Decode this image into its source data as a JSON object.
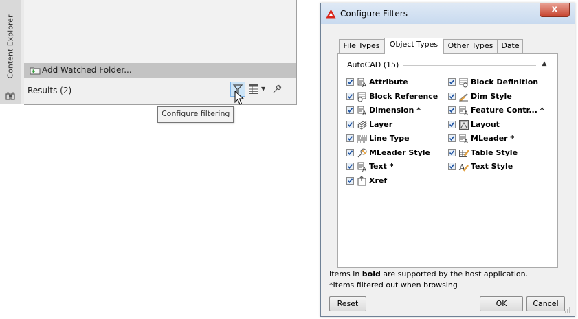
{
  "palette": {
    "vertical_title": "Content Explorer",
    "add_watched_folder_label": "Add Watched Folder...",
    "results_label": "Results (2)",
    "tooltip": "Configure filtering",
    "icons": [
      "binoculars-icon",
      "folder-add-icon",
      "filter-icon",
      "grid-view-icon",
      "dropdown-arrow-icon",
      "wrench-icon",
      "mouse-cursor-icon"
    ]
  },
  "dialog": {
    "title": "Configure Filters",
    "close_label": "x",
    "tabs": [
      {
        "label": "File Types",
        "active": false
      },
      {
        "label": "Object Types",
        "active": true
      },
      {
        "label": "Other Types",
        "active": false
      },
      {
        "label": "Date",
        "active": false
      }
    ],
    "group": {
      "label": "AutoCAD (15)",
      "collapse_icon": "chevron-up-icon"
    },
    "items": [
      {
        "label": "Attribute",
        "checked": true,
        "icon": "attribute-icon"
      },
      {
        "label": "Block Definition",
        "checked": true,
        "icon": "block-definition-icon"
      },
      {
        "label": "Block Reference",
        "checked": true,
        "icon": "block-reference-icon"
      },
      {
        "label": "Dim Style",
        "checked": true,
        "icon": "dim-style-icon"
      },
      {
        "label": "Dimension *",
        "checked": true,
        "icon": "dimension-icon"
      },
      {
        "label": "Feature Contr... *",
        "checked": true,
        "icon": "feature-control-icon"
      },
      {
        "label": "Layer",
        "checked": true,
        "icon": "layer-icon"
      },
      {
        "label": "Layout",
        "checked": true,
        "icon": "layout-icon"
      },
      {
        "label": "Line Type",
        "checked": true,
        "icon": "line-type-icon"
      },
      {
        "label": "MLeader *",
        "checked": true,
        "icon": "mleader-icon"
      },
      {
        "label": "MLeader Style",
        "checked": true,
        "icon": "mleader-style-icon"
      },
      {
        "label": "Table Style",
        "checked": true,
        "icon": "table-style-icon"
      },
      {
        "label": "Text *",
        "checked": true,
        "icon": "text-icon"
      },
      {
        "label": "Text Style",
        "checked": true,
        "icon": "text-style-icon"
      },
      {
        "label": "Xref",
        "checked": true,
        "icon": "xref-icon"
      }
    ],
    "footnote_prefix": "Items in ",
    "footnote_bold": "bold",
    "footnote_suffix": " are supported by the host application.",
    "footnote2": "*Items filtered out when browsing",
    "buttons": {
      "reset": "Reset",
      "ok": "OK",
      "cancel": "Cancel"
    }
  },
  "colors": {
    "accent": "#cce4f7",
    "close_button": "#c7442f",
    "checkbox": "#1a4fa0"
  }
}
